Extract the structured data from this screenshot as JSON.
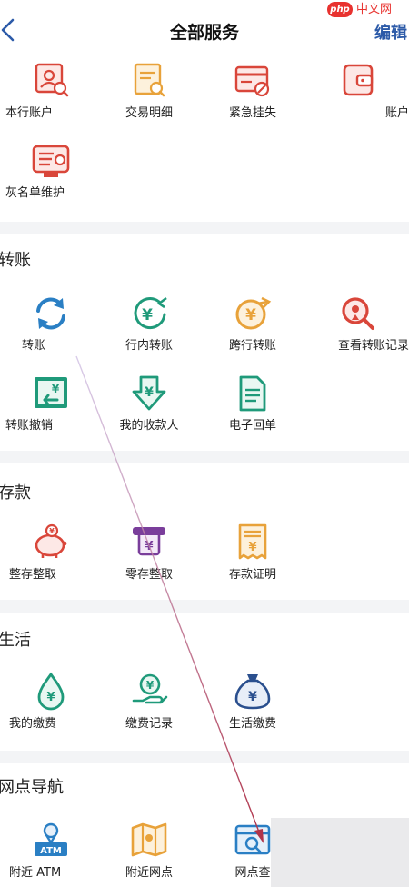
{
  "header": {
    "title": "全部服务",
    "edit_label": "编辑"
  },
  "watermark": {
    "badge": "php",
    "text": "中文网"
  },
  "sections": {
    "account": {
      "items": [
        {
          "label": "本行账户",
          "icon": "account-person-icon"
        },
        {
          "label": "交易明细",
          "icon": "transaction-detail-icon"
        },
        {
          "label": "紧急挂失",
          "icon": "card-lost-icon"
        },
        {
          "label": "账户",
          "icon": "wallet-icon"
        },
        {
          "label": "灰名单维护",
          "icon": "graylist-card-icon"
        }
      ]
    },
    "transfer": {
      "title": "转账",
      "items": [
        {
          "label": "转账",
          "icon": "refresh-transfer-icon"
        },
        {
          "label": "行内转账",
          "icon": "yuan-in-icon"
        },
        {
          "label": "跨行转账",
          "icon": "yuan-out-icon"
        },
        {
          "label": "查看转账记录",
          "icon": "search-record-icon"
        },
        {
          "label": "转账撤销",
          "icon": "undo-transfer-icon"
        },
        {
          "label": "我的收款人",
          "icon": "payee-download-icon"
        },
        {
          "label": "电子回单",
          "icon": "document-icon"
        }
      ]
    },
    "deposit": {
      "title": "存款",
      "items": [
        {
          "label": "整存整取",
          "icon": "piggy-bank-icon"
        },
        {
          "label": "零存整取",
          "icon": "atm-slot-icon"
        },
        {
          "label": "存款证明",
          "icon": "certificate-icon"
        }
      ]
    },
    "life": {
      "title": "生活",
      "items": [
        {
          "label": "我的缴费",
          "icon": "water-drop-yuan-icon"
        },
        {
          "label": "缴费记录",
          "icon": "hand-yuan-icon"
        },
        {
          "label": "生活缴费",
          "icon": "money-bag-icon"
        }
      ]
    },
    "nav": {
      "title": "网点导航",
      "items": [
        {
          "label": "附近 ATM",
          "icon": "atm-location-icon"
        },
        {
          "label": "附近网点",
          "icon": "map-location-icon"
        },
        {
          "label": "网点查",
          "icon": "branch-query-icon"
        }
      ]
    }
  },
  "colors": {
    "accent": "#2c5aa8",
    "icon_red": "#d9463a",
    "icon_orange": "#e8a23a",
    "icon_blue": "#2a7fc4",
    "icon_green": "#1f9a7a",
    "annotation_arrow": "#b0344a"
  }
}
